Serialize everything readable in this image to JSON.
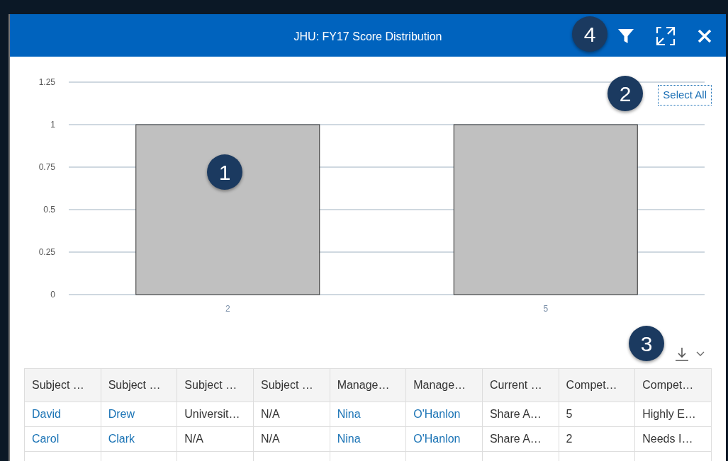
{
  "window": {
    "title": "JHU: FY17 Score Distribution"
  },
  "toolbar": {
    "select_all": "Select All"
  },
  "chart": {
    "chart_data": {
      "type": "bar",
      "grid": true,
      "categories": [
        "2",
        "5"
      ],
      "values": [
        1,
        1
      ],
      "ylim": [
        0,
        1.25
      ],
      "yticks": [
        0,
        {
          "value": 0.25,
          "label": "0.25"
        },
        {
          "value": 0.5,
          "label": "0.5"
        },
        {
          "value": 0.75,
          "label": "0.75"
        },
        1,
        {
          "value": 1.25,
          "label": "1.25"
        }
      ]
    }
  },
  "table": {
    "columns": [
      "Subject …",
      "Subject …",
      "Subject …",
      "Subject …",
      "Manage…",
      "Manage…",
      "Current …",
      "Compet…",
      "Compet…"
    ],
    "rows": [
      [
        {
          "text": "David",
          "link": true
        },
        {
          "text": "Drew",
          "link": true
        },
        {
          "text": "Universit…",
          "link": false
        },
        {
          "text": "N/A",
          "link": false
        },
        {
          "text": "Nina",
          "link": true
        },
        {
          "text": "O'Hanlon",
          "link": true
        },
        {
          "text": "Share A…",
          "link": false
        },
        {
          "text": "5",
          "link": false
        },
        {
          "text": "Highly E…",
          "link": false
        }
      ],
      [
        {
          "text": "Carol",
          "link": true
        },
        {
          "text": "Clark",
          "link": true
        },
        {
          "text": "N/A",
          "link": false
        },
        {
          "text": "N/A",
          "link": false
        },
        {
          "text": "Nina",
          "link": true
        },
        {
          "text": "O'Hanlon",
          "link": true
        },
        {
          "text": "Share A…",
          "link": false
        },
        {
          "text": "2",
          "link": false
        },
        {
          "text": "Needs I…",
          "link": false
        }
      ]
    ]
  },
  "callouts": [
    "1",
    "2",
    "3",
    "4"
  ]
}
